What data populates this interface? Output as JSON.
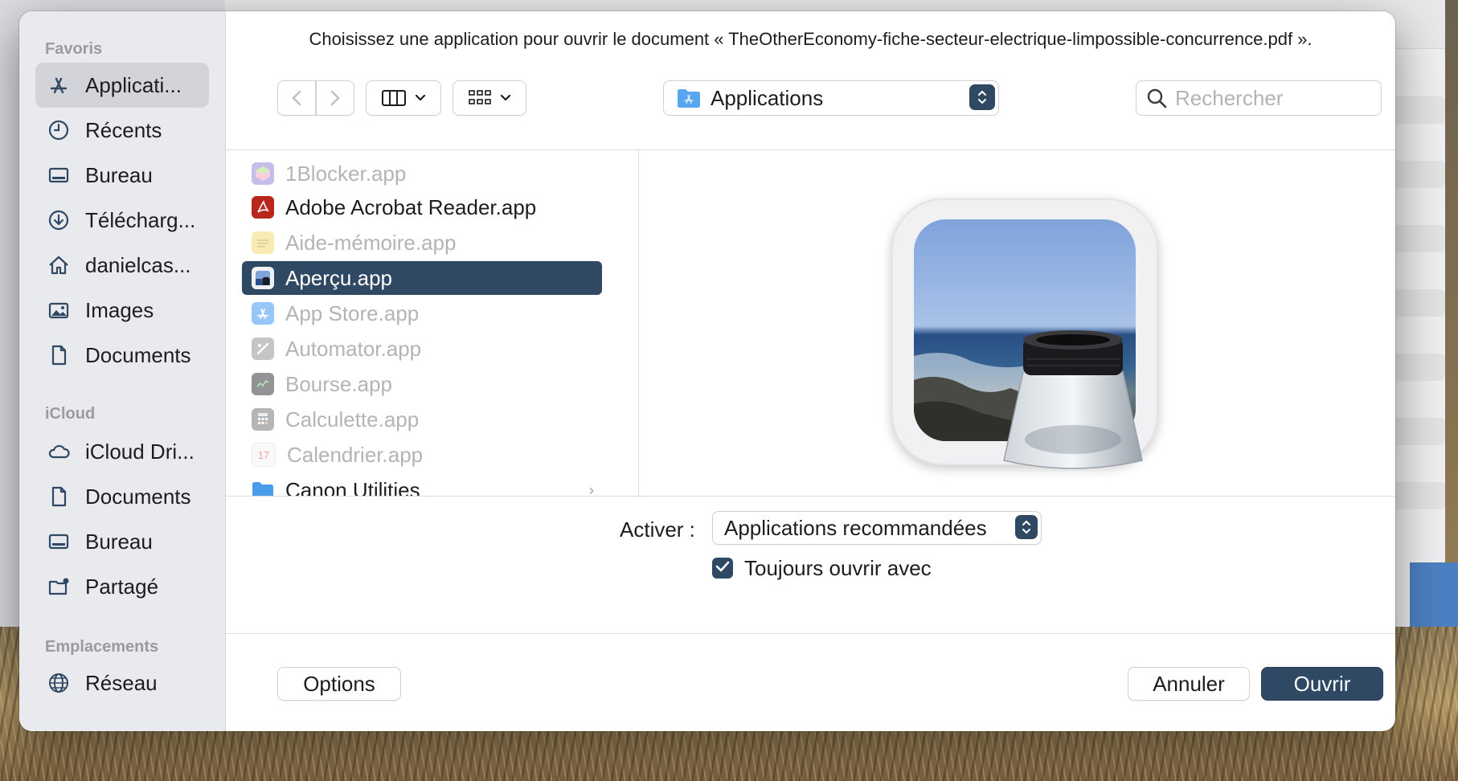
{
  "dialog": {
    "prompt": "Choisissez une application pour ouvrir le document « TheOtherEconomy-fiche-secteur-electrique-limpossible-concurrence.pdf »."
  },
  "sidebar": {
    "favorites_title": "Favoris",
    "favorites": [
      {
        "label": "Applicati...",
        "icon": "applications-icon",
        "selected": true
      },
      {
        "label": "Récents",
        "icon": "clock-icon"
      },
      {
        "label": "Bureau",
        "icon": "desktop-icon"
      },
      {
        "label": "Télécharg...",
        "icon": "downloads-icon"
      },
      {
        "label": "danielcas...",
        "icon": "home-icon"
      },
      {
        "label": "Images",
        "icon": "photo-icon"
      },
      {
        "label": "Documents",
        "icon": "document-icon"
      }
    ],
    "icloud_title": "iCloud",
    "icloud": [
      {
        "label": "iCloud Dri...",
        "icon": "cloud-icon"
      },
      {
        "label": "Documents",
        "icon": "document-icon"
      },
      {
        "label": "Bureau",
        "icon": "desktop-icon"
      },
      {
        "label": "Partagé",
        "icon": "shared-folder-icon"
      }
    ],
    "locations_title": "Emplacements",
    "locations": [
      {
        "label": "Réseau",
        "icon": "network-icon"
      }
    ]
  },
  "toolbar": {
    "location": "Applications",
    "search_placeholder": "Rechercher"
  },
  "files": [
    {
      "label": "1Blocker.app",
      "dim": true,
      "icon_color": "#8d7fd6"
    },
    {
      "label": "Adobe Acrobat Reader.app",
      "dim": false,
      "icon_color": "#b8261c"
    },
    {
      "label": "Aide-mémoire.app",
      "dim": true,
      "icon_color": "#f2d86a"
    },
    {
      "label": "Aperçu.app",
      "dim": false,
      "selected": true,
      "icon_color": "#6f93c9"
    },
    {
      "label": "App Store.app",
      "dim": true,
      "icon_color": "#2f8ef6"
    },
    {
      "label": "Automator.app",
      "dim": true,
      "icon_color": "#8c8c92"
    },
    {
      "label": "Bourse.app",
      "dim": true,
      "icon_color": "#2a2a2e"
    },
    {
      "label": "Calculette.app",
      "dim": true,
      "icon_color": "#6d6d72"
    },
    {
      "label": "Calendrier.app",
      "dim": true,
      "icon_color": "#f4f4f4"
    },
    {
      "label": "Canon Utilities",
      "dim": false,
      "icon_color": "#4a9be8",
      "folder": true
    }
  ],
  "calendar_icon_text": "17",
  "options": {
    "enable_label": "Activer :",
    "enable_value": "Applications recommandées",
    "always_open_label": "Toujours ouvrir avec",
    "always_open_checked": true
  },
  "buttons": {
    "options": "Options",
    "cancel": "Annuler",
    "open": "Ouvrir"
  },
  "colors": {
    "accent": "#2f4863"
  }
}
